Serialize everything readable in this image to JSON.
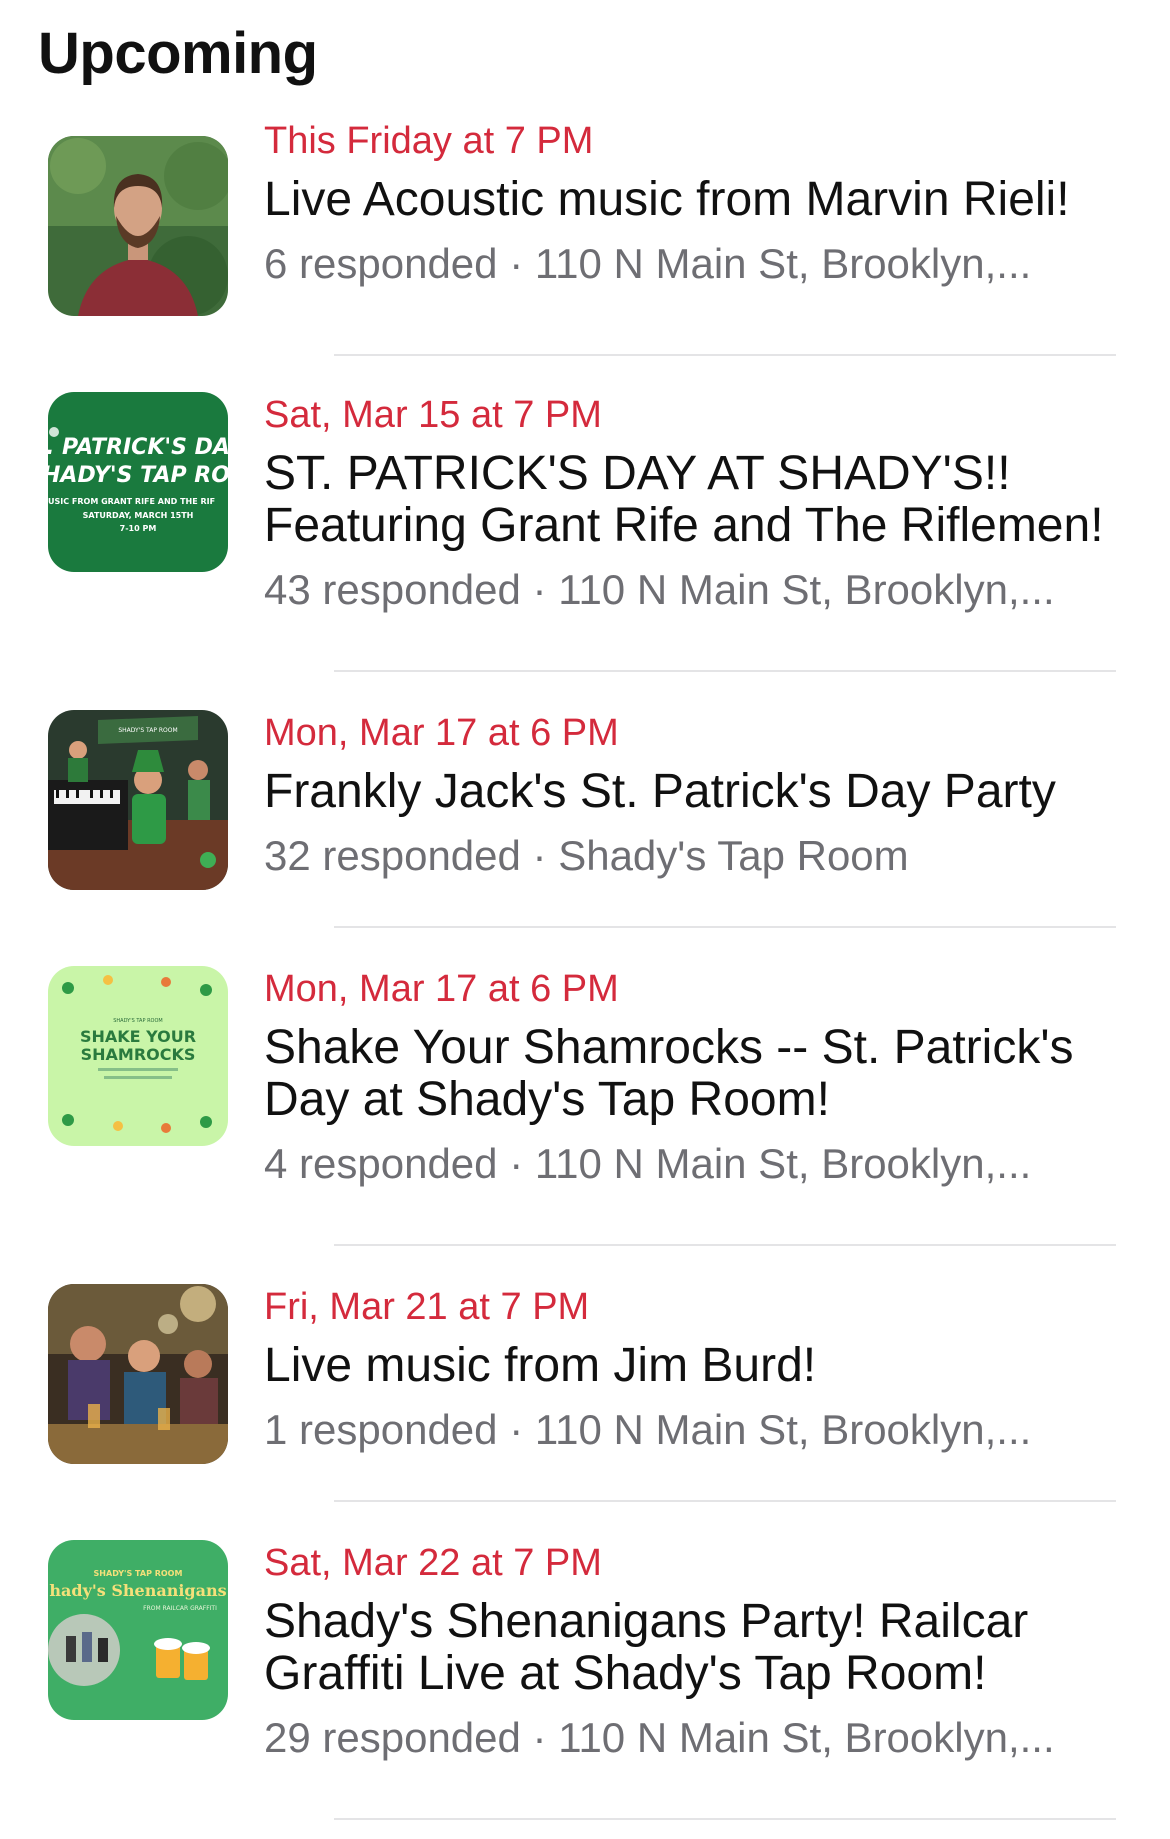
{
  "section_title": "Upcoming",
  "events": [
    {
      "when": "This Friday at 7 PM",
      "title_lines": [
        "Live Acoustic music from Marvin Rieli!"
      ],
      "meta": "6 responded · 110 N Main St, Brooklyn,...",
      "thumb_icon": "portrait-photo"
    },
    {
      "when": "Sat, Mar 15 at 7 PM",
      "title_lines": [
        "ST. PATRICK'S DAY AT SHADY'S!!",
        "Featuring Grant Rife and The Riflemen!"
      ],
      "meta": "43 responded · 110 N Main St, Brooklyn,...",
      "thumb_icon": "green-poster",
      "thumb_text": {
        "line1": ". PATRICK'S DA",
        "line2": "HADY'S TAP RO",
        "line3": "USIC FROM GRANT RIFE AND THE RIF",
        "line4": "SATURDAY, MARCH 15TH",
        "line5": "7-10 PM"
      }
    },
    {
      "when": "Mon, Mar 17 at 6 PM",
      "title_lines": [
        "Frankly Jack's St. Patrick's Day Party"
      ],
      "meta": "32 responded · Shady's Tap Room",
      "thumb_icon": "piano-party-illustration"
    },
    {
      "when": "Mon, Mar 17 at 6 PM",
      "title_lines": [
        "Shake Your Shamrocks -- St. Patrick's",
        "Day at Shady's Tap Room!"
      ],
      "meta": "4 responded · 110 N Main St, Brooklyn,...",
      "thumb_icon": "shamrock-poster",
      "thumb_text": {
        "line1": "SHADY'S TAP ROOM",
        "line2": "SHAKE YOUR",
        "line3": "SHAMROCKS"
      }
    },
    {
      "when": "Fri, Mar 21 at 7 PM",
      "title_lines": [
        "Live music from Jim Burd!"
      ],
      "meta": "1 responded · 110 N Main St, Brooklyn,...",
      "thumb_icon": "bar-crowd-photo"
    },
    {
      "when": "Sat, Mar 22 at 7 PM",
      "title_lines": [
        "Shady's Shenanigans Party! Railcar",
        "Graffiti Live at Shady's Tap Room!"
      ],
      "meta": "29 responded · 110 N Main St, Brooklyn,...",
      "thumb_icon": "shenanigans-poster",
      "thumb_text": {
        "line1": "SHADY'S TAP ROOM",
        "line2": "hady's Shenanigans",
        "line3": "FROM RAILCAR GRAFFITI"
      }
    }
  ],
  "colors": {
    "date_red": "#d42a3c",
    "meta_gray": "#6e6e73",
    "divider": "#e4e4e6"
  }
}
